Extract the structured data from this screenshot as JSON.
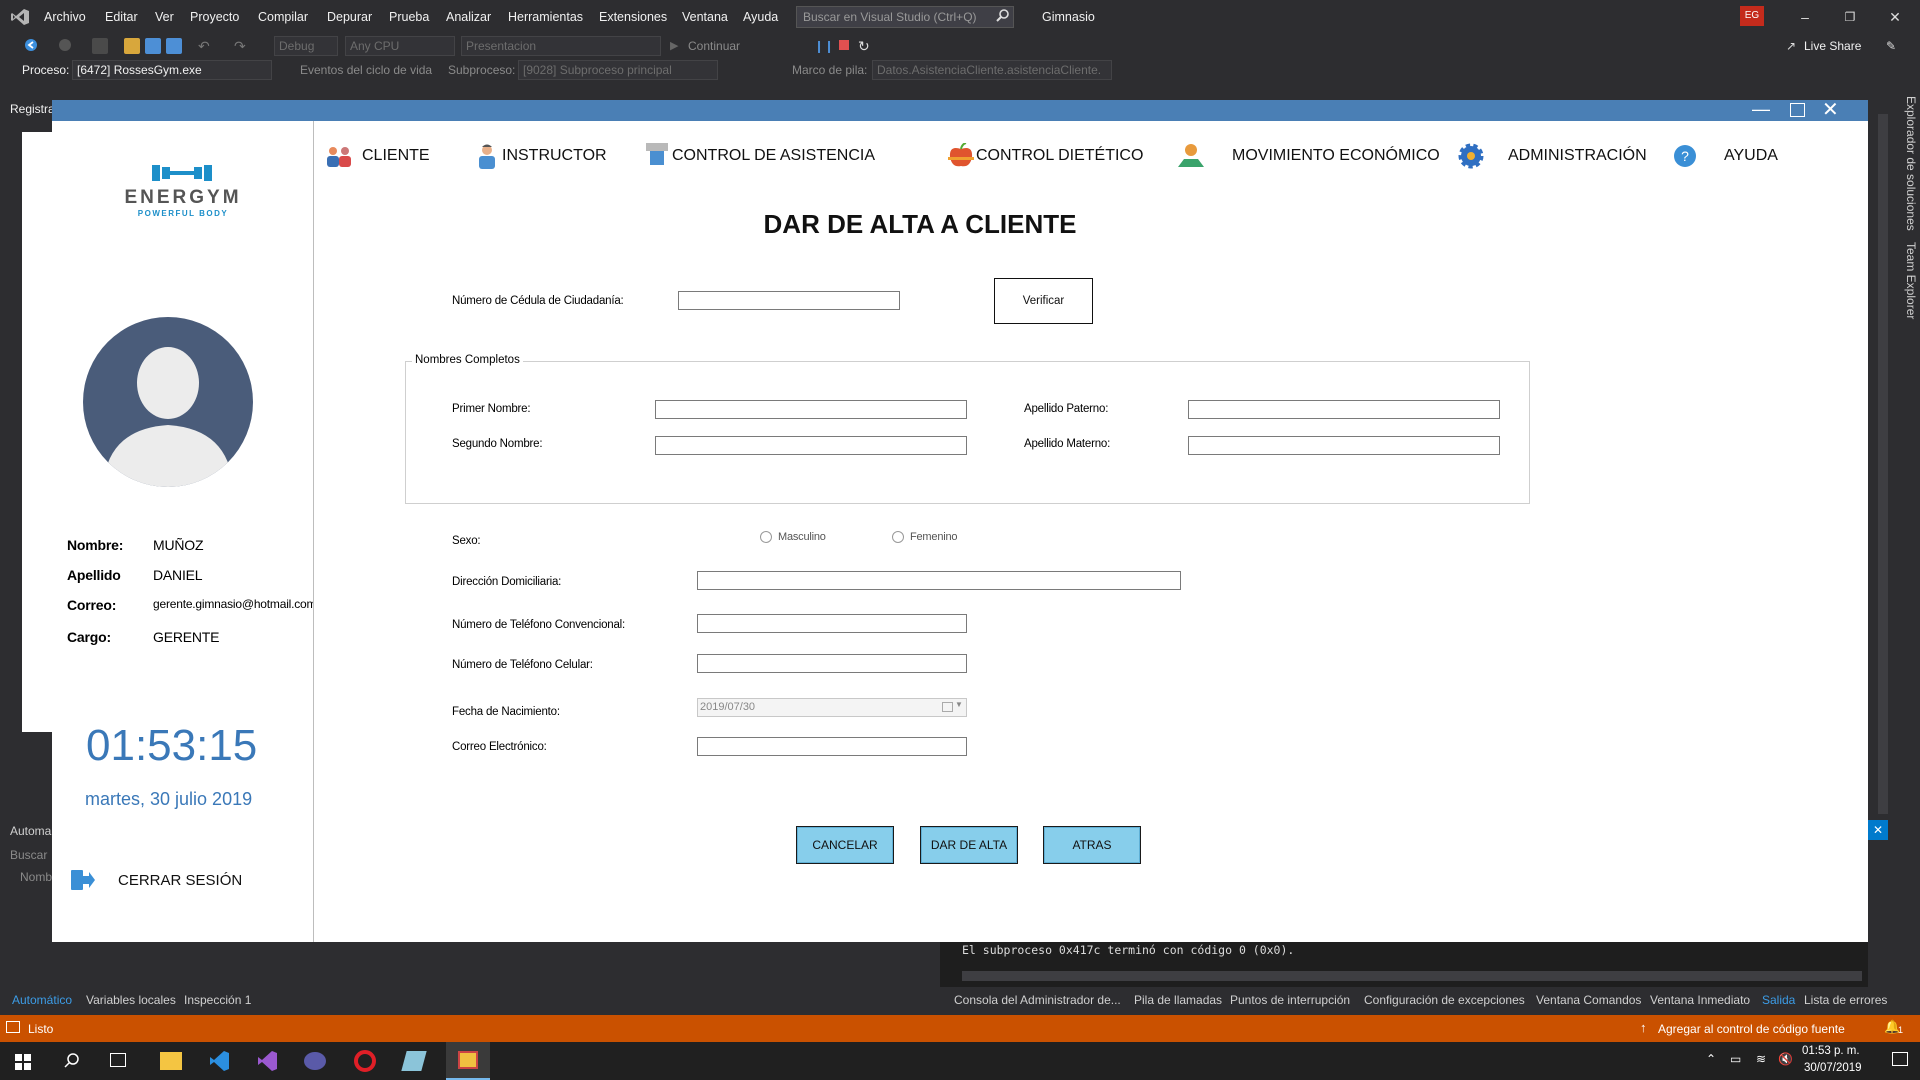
{
  "vs": {
    "menu": [
      "Archivo",
      "Editar",
      "Ver",
      "Proyecto",
      "Compilar",
      "Depurar",
      "Prueba",
      "Analizar",
      "Herramientas",
      "Extensiones",
      "Ventana",
      "Ayuda"
    ],
    "search_placeholder": "Buscar en Visual Studio (Ctrl+Q)",
    "solution_name": "Gimnasio",
    "user_initials": "EG",
    "config": "Debug",
    "platform": "Any CPU",
    "startup_project": "Presentacion",
    "continue_label": "Continuar",
    "live_share": "Live Share",
    "process_label": "Proceso:",
    "process_value": "[6472] RossesGym.exe",
    "lifecycle_label": "Eventos del ciclo de vida",
    "thread_label": "Subproceso:",
    "thread_value": "[9028] Subproceso principal",
    "stack_label": "Marco de pila:",
    "stack_value": "Datos.AsistenciaCliente.asistenciaCliente.",
    "left_labels": {
      "registro": "Registra",
      "automatico": "Automa",
      "buscar": "Buscar",
      "nombre": "Nomb"
    },
    "right_tabs": [
      "Explorador de soluciones",
      "Team Explorer"
    ],
    "output_text": "El subproceso 0x417c terminó con código 0 (0x0).",
    "bottom_tabs_left": [
      "Automático",
      "Variables locales",
      "Inspección 1"
    ],
    "bottom_tabs_right": [
      "Consola del Administrador de...",
      "Pila de llamadas",
      "Puntos de interrupción",
      "Configuración de excepciones",
      "Ventana Comandos",
      "Ventana Inmediato",
      "Salida",
      "Lista de errores"
    ],
    "status_text": "Listo",
    "source_control": "Agregar al control de código fuente",
    "notifications_count": "1"
  },
  "taskbar": {
    "time": "01:53 p. m.",
    "date": "30/07/2019"
  },
  "app": {
    "brand_name": "ENERGYM",
    "brand_tagline": "POWERFUL BODY",
    "nav": [
      {
        "label": "CLIENTE"
      },
      {
        "label": "INSTRUCTOR"
      },
      {
        "label": "CONTROL DE ASISTENCIA"
      },
      {
        "label": "CONTROL DIETÉTICO"
      },
      {
        "label": "MOVIMIENTO ECONÓMICO"
      },
      {
        "label": "ADMINISTRACIÓN"
      },
      {
        "label": "AYUDA"
      }
    ],
    "user": {
      "nombre_label": "Nombre:",
      "nombre": "MUÑOZ",
      "apellido_label": "Apellido",
      "apellido": "DANIEL",
      "correo_label": "Correo:",
      "correo": "gerente.gimnasio@hotmail.com",
      "cargo_label": "Cargo:",
      "cargo": "GERENTE"
    },
    "clock": "01:53:15",
    "date": "martes, 30 julio 2019",
    "logout": "CERRAR SESIÓN",
    "form": {
      "title": "DAR DE ALTA A CLIENTE",
      "cedula_label": "Número de Cédula de Ciudadanía:",
      "verify_button": "Verificar",
      "group_label": "Nombres Completos",
      "primer_nombre": "Primer Nombre:",
      "segundo_nombre": "Segundo Nombre:",
      "apellido_paterno": "Apellido Paterno:",
      "apellido_materno": "Apellido Materno:",
      "sexo_label": "Sexo:",
      "sexo_options": [
        "Masculino",
        "Femenino"
      ],
      "direccion": "Dirección Domiciliaria:",
      "telefono_conv": "Número de Teléfono Convencional:",
      "telefono_cel": "Número de Teléfono Celular:",
      "fecha_label": "Fecha de Nacimiento:",
      "fecha_value": "2019/07/30",
      "correo_label": "Correo Electrónico:",
      "buttons": {
        "cancel": "CANCELAR",
        "submit": "DAR DE ALTA",
        "back": "ATRAS"
      }
    }
  },
  "colors": {
    "vs_bg": "#2d2d30",
    "status": "#ca5100",
    "app_title": "#4a7fb5",
    "accent_blue": "#3a78b8",
    "button": "#87ceeb"
  }
}
